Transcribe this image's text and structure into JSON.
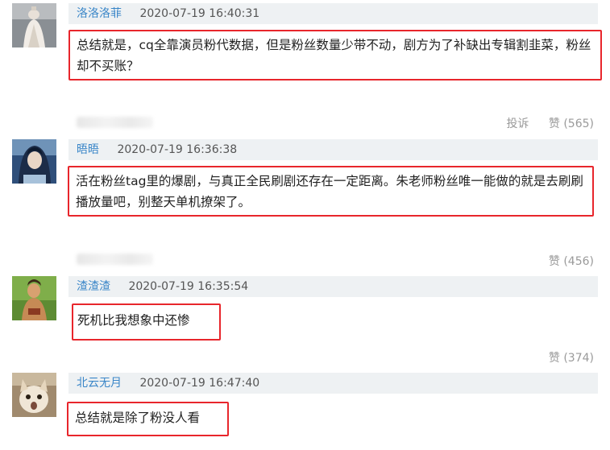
{
  "comments": [
    {
      "user": "洛洛洛菲",
      "time": "2020-07-19 16:40:31",
      "text": "总结就是，cq全靠演员粉代数据，但是粉丝数量少带不动，剧方为了补缺出专辑割韭菜，粉丝却不买账？",
      "report": "投诉",
      "likes": "赞 (565)"
    },
    {
      "user": "晤晤",
      "time": "2020-07-19 16:36:38",
      "text": "活在粉丝tag里的爆剧，与真正全民刷剧还存在一定距离。朱老师粉丝唯一能做的就是去刷刷播放量吧，别整天单机撩架了。",
      "likes": "赞 (456)"
    },
    {
      "user": "渣渣渣",
      "time": "2020-07-19 16:35:54",
      "text": "死机比我想象中还惨",
      "likes": "赞 (374)"
    },
    {
      "user": "北云无月",
      "time": "2020-07-19 16:47:40",
      "text": "总结就是除了粉没人看"
    }
  ],
  "colors": {
    "highlight_border": "#e8262c",
    "username": "#3a86c8",
    "meta_bg": "#eef1f3"
  },
  "icons": [
    "avatar-statue",
    "avatar-anime-character",
    "avatar-game-warrior",
    "avatar-cat"
  ]
}
